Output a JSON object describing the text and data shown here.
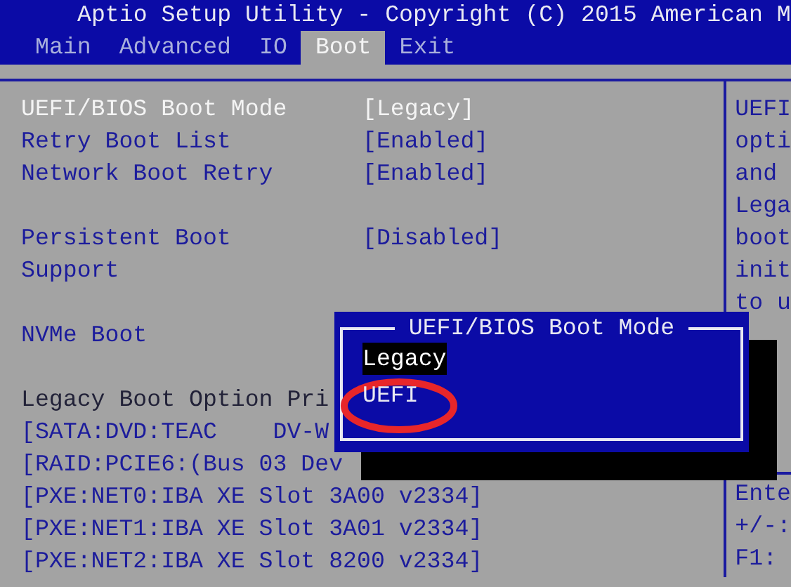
{
  "title": "Aptio Setup Utility - Copyright (C) 2015 American M",
  "tabs": [
    {
      "label": "Main",
      "selected": false
    },
    {
      "label": "Advanced",
      "selected": false
    },
    {
      "label": "IO",
      "selected": false
    },
    {
      "label": "Boot",
      "selected": true
    },
    {
      "label": "Exit",
      "selected": false
    }
  ],
  "rows": [
    {
      "kind": "setting",
      "label": "UEFI/BIOS Boot Mode",
      "value": "[Legacy]",
      "selected": true
    },
    {
      "kind": "setting",
      "label": "Retry Boot List",
      "value": "[Enabled]",
      "selected": false
    },
    {
      "kind": "setting",
      "label": "Network Boot Retry",
      "value": "[Enabled]",
      "selected": false
    },
    {
      "kind": "gap"
    },
    {
      "kind": "setting",
      "label": "Persistent Boot Support",
      "value": "[Disabled]",
      "selected": false
    },
    {
      "kind": "gap"
    },
    {
      "kind": "setting",
      "label": "NVMe Boot",
      "selected": false
    },
    {
      "kind": "gap"
    },
    {
      "kind": "heading",
      "label": "Legacy Boot Option Pri"
    },
    {
      "kind": "option",
      "label": "[SATA:DVD:TEAC    DV-W"
    },
    {
      "kind": "option",
      "label": "[RAID:PCIE6:(Bus 03 Dev"
    },
    {
      "kind": "option",
      "label": "[PXE:NET0:IBA XE Slot 3A00 v2334]"
    },
    {
      "kind": "option",
      "label": "[PXE:NET1:IBA XE Slot 3A01 v2334]"
    },
    {
      "kind": "option",
      "label": "[PXE:NET2:IBA XE Slot 8200 v2334]"
    }
  ],
  "help_top": [
    "UEFI",
    "opti",
    "and",
    "Lega",
    "boot",
    "init",
    "to u"
  ],
  "help_bottom": [
    "Ente",
    "+/-:",
    "F1:"
  ],
  "popup": {
    "title": "UEFI/BIOS Boot Mode",
    "options": [
      {
        "label": "Legacy",
        "selected": true
      },
      {
        "label": "UEFI",
        "selected": false
      }
    ]
  }
}
